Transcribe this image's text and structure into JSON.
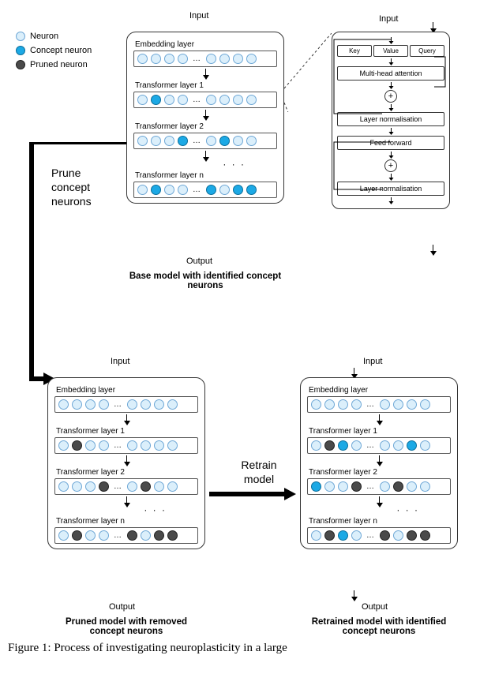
{
  "legend": {
    "neuron": "Neuron",
    "concept": "Concept neuron",
    "pruned": "Pruned neuron"
  },
  "io": {
    "input": "Input",
    "output": "Output"
  },
  "layers": {
    "embedding": "Embedding layer",
    "t1": "Transformer layer 1",
    "t2": "Transformer layer 2",
    "tn": "Transformer layer n"
  },
  "captions": {
    "base": "Base model with identified concept neurons",
    "pruned": "Pruned model with removed concept neurons",
    "retrained": "Retrained model with identified concept neurons"
  },
  "actions": {
    "prune": "Prune concept neurons",
    "retrain": "Retrain model"
  },
  "transformer_detail": {
    "key": "Key",
    "value": "Value",
    "query": "Query",
    "mha": "Multi-head attention",
    "ln": "Layer normalisation",
    "ff": "Feed forward",
    "plus": "+"
  },
  "figure_caption": "Figure 1: Process of investigating neuroplasticity in a large",
  "chart_data": {
    "type": "diagram",
    "stages": [
      {
        "name": "Base model with identified concept neurons",
        "has_concept_neurons": true,
        "has_pruned_neurons": false
      },
      {
        "name": "Pruned model with removed concept neurons",
        "has_concept_neurons": false,
        "has_pruned_neurons": true
      },
      {
        "name": "Retrained model with identified concept neurons",
        "has_concept_neurons": true,
        "has_pruned_neurons": true
      }
    ],
    "transitions": [
      {
        "from": 0,
        "to": 1,
        "action": "Prune concept neurons"
      },
      {
        "from": 1,
        "to": 2,
        "action": "Retrain model"
      }
    ],
    "neuron_types": [
      "Neuron",
      "Concept neuron",
      "Pruned neuron"
    ],
    "transformer_block_components": [
      "Key/Value/Query",
      "Multi-head attention",
      "residual add",
      "Layer normalisation",
      "Feed forward",
      "residual add",
      "Layer normalisation"
    ]
  }
}
